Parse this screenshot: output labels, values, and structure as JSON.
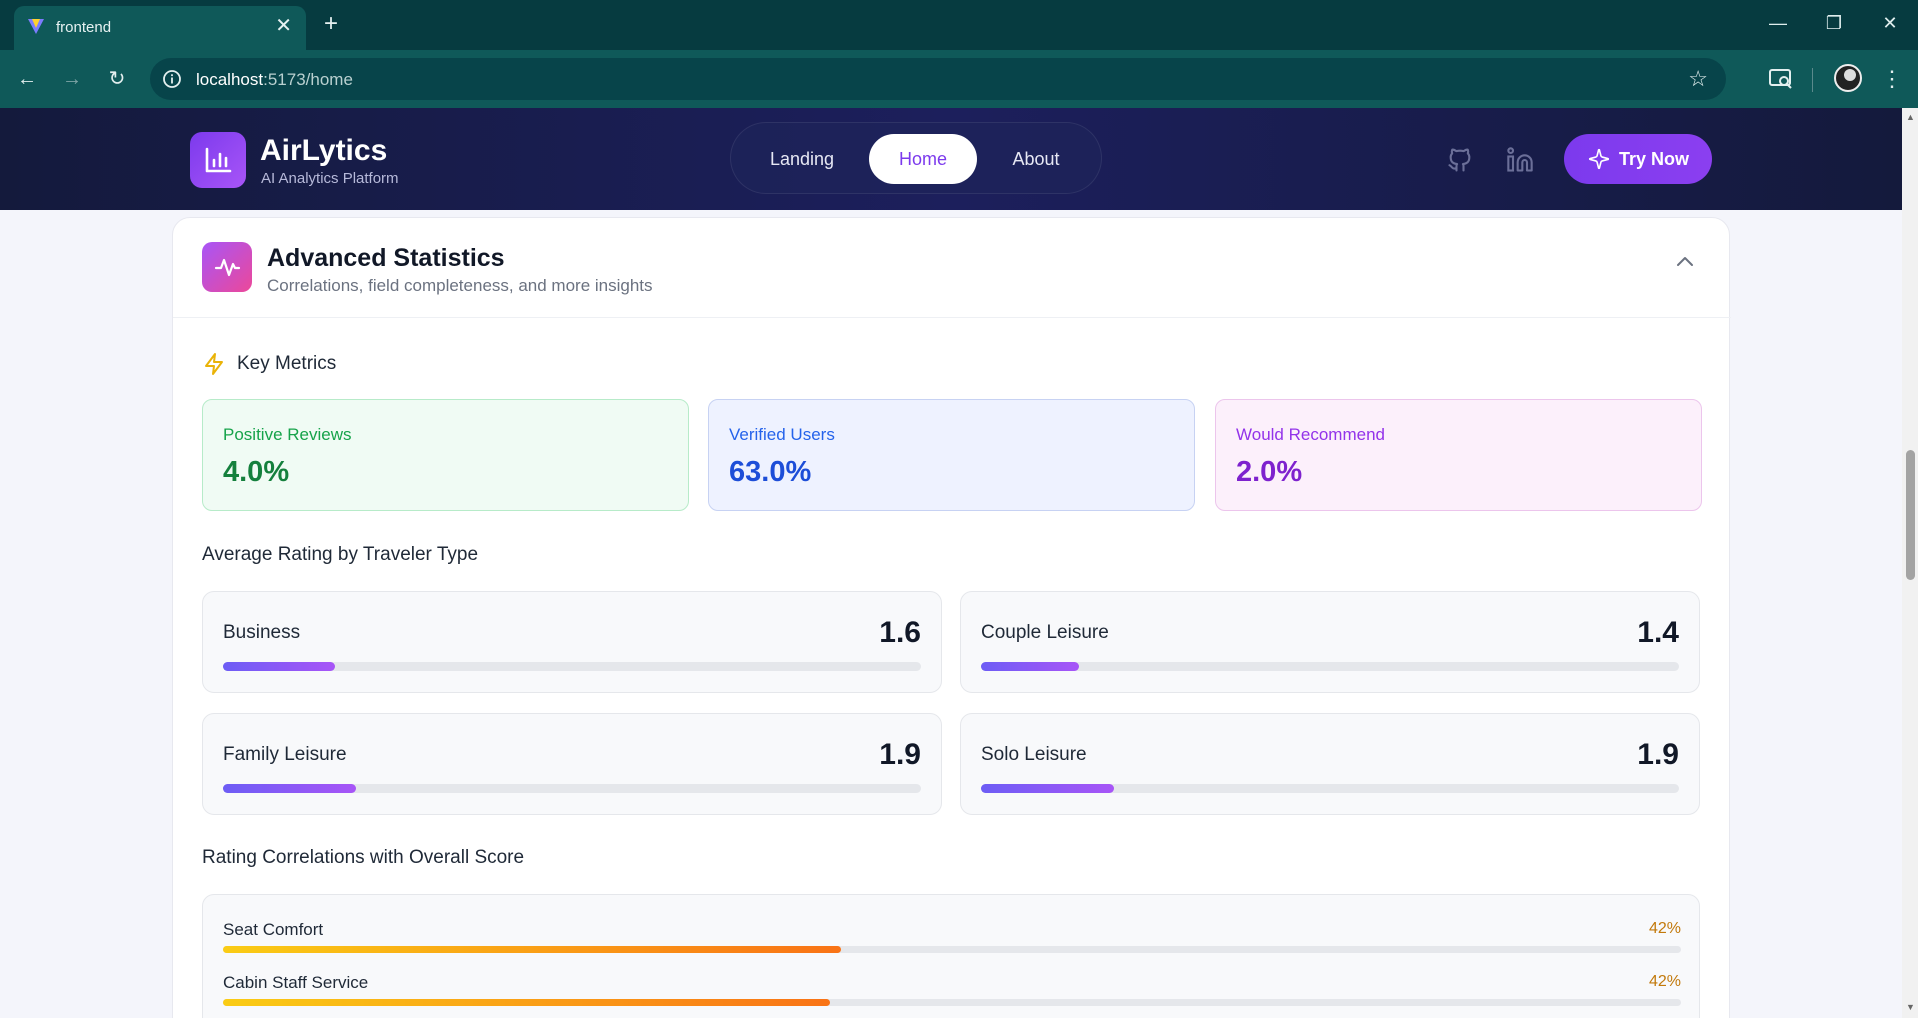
{
  "browser": {
    "tab_title": "frontend",
    "close_glyph": "✕",
    "newtab_glyph": "+",
    "url_host": "localhost",
    "url_path": ":5173/home",
    "window_min": "—",
    "window_restore": "❐",
    "window_close": "✕",
    "back_glyph": "←",
    "forward_glyph": "→",
    "reload_glyph": "↻",
    "star_glyph": "☆",
    "menu_glyph": "⋮"
  },
  "app": {
    "brand": "AirLytics",
    "brand_sub": "AI Analytics Platform",
    "nav": [
      {
        "label": "Landing"
      },
      {
        "label": "Home"
      },
      {
        "label": "About"
      }
    ],
    "active_nav": "Home",
    "cta_label": "Try Now",
    "icons": [
      "bar-chart-icon",
      "github-icon",
      "linkedin-icon",
      "sparkles-icon"
    ]
  },
  "panel": {
    "title": "Advanced Statistics",
    "subtitle": "Correlations, field completeness, and more insights",
    "expanded": true
  },
  "key_metrics": {
    "title": "Key Metrics",
    "items": [
      {
        "label": "Positive Reviews",
        "value": "4.0%"
      },
      {
        "label": "Verified Users",
        "value": "63.0%"
      },
      {
        "label": "Would Recommend",
        "value": "2.0%"
      }
    ]
  },
  "traveler": {
    "title": "Average Rating by Traveler Type",
    "scale_max": 10,
    "items": [
      {
        "name": "Business",
        "score": "1.6",
        "value": 1.6
      },
      {
        "name": "Couple Leisure",
        "score": "1.4",
        "value": 1.4
      },
      {
        "name": "Family Leisure",
        "score": "1.9",
        "value": 1.9
      },
      {
        "name": "Solo Leisure",
        "score": "1.9",
        "value": 1.9
      }
    ]
  },
  "correlations": {
    "title": "Rating Correlations with Overall Score",
    "items": [
      {
        "name": "Seat Comfort",
        "pct": "42%",
        "value": 0.424
      },
      {
        "name": "Cabin Staff Service",
        "pct": "42%",
        "value": 0.416
      }
    ]
  },
  "colors": {
    "accent": "#7c3aed",
    "positive": "#15803d",
    "verified": "#1d4ed8",
    "recommend": "#7e22ce",
    "corr_pct": "#c2790b"
  }
}
